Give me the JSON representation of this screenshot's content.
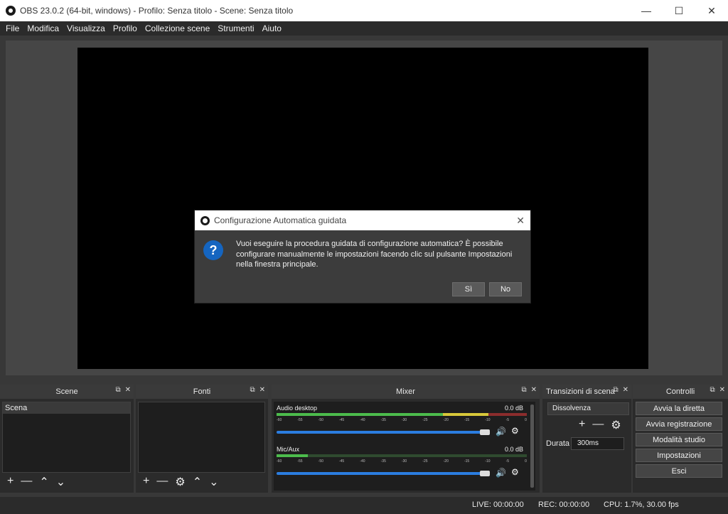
{
  "window": {
    "title": "OBS 23.0.2 (64-bit, windows) - Profilo: Senza titolo - Scene: Senza titolo"
  },
  "menu": [
    "File",
    "Modifica",
    "Visualizza",
    "Profilo",
    "Collezione scene",
    "Strumenti",
    "Aiuto"
  ],
  "dialog": {
    "title": "Configurazione Automatica guidata",
    "message": "Vuoi eseguire la procedura guidata di configurazione automatica?  È possibile configurare manualmente le impostazioni facendo clic sul pulsante Impostazioni nella finestra principale.",
    "yes": "Sì",
    "no": "No"
  },
  "scenes": {
    "title": "Scene",
    "items": [
      "Scena"
    ]
  },
  "sources": {
    "title": "Fonti"
  },
  "mixer": {
    "title": "Mixer",
    "tracks": [
      {
        "name": "Audio desktop",
        "db": "0.0 dB"
      },
      {
        "name": "Mic/Aux",
        "db": "0.0 dB"
      }
    ],
    "ticks": [
      "-60",
      "-55",
      "-50",
      "-45",
      "-40",
      "-35",
      "-30",
      "-25",
      "-20",
      "-15",
      "-10",
      "-5",
      "0"
    ]
  },
  "transitions": {
    "title": "Transizioni di scena",
    "selected": "Dissolvenza",
    "duration_label": "Durata",
    "duration": "300ms"
  },
  "controls": {
    "title": "Controlli",
    "buttons": [
      "Avvia la diretta",
      "Avvia registrazione",
      "Modalità studio",
      "Impostazioni",
      "Esci"
    ]
  },
  "status": {
    "live": "LIVE: 00:00:00",
    "rec": "REC: 00:00:00",
    "cpu": "CPU: 1.7%, 30.00 fps"
  },
  "colors": {
    "accent": "#2b7de0",
    "question": "#1565c0"
  }
}
